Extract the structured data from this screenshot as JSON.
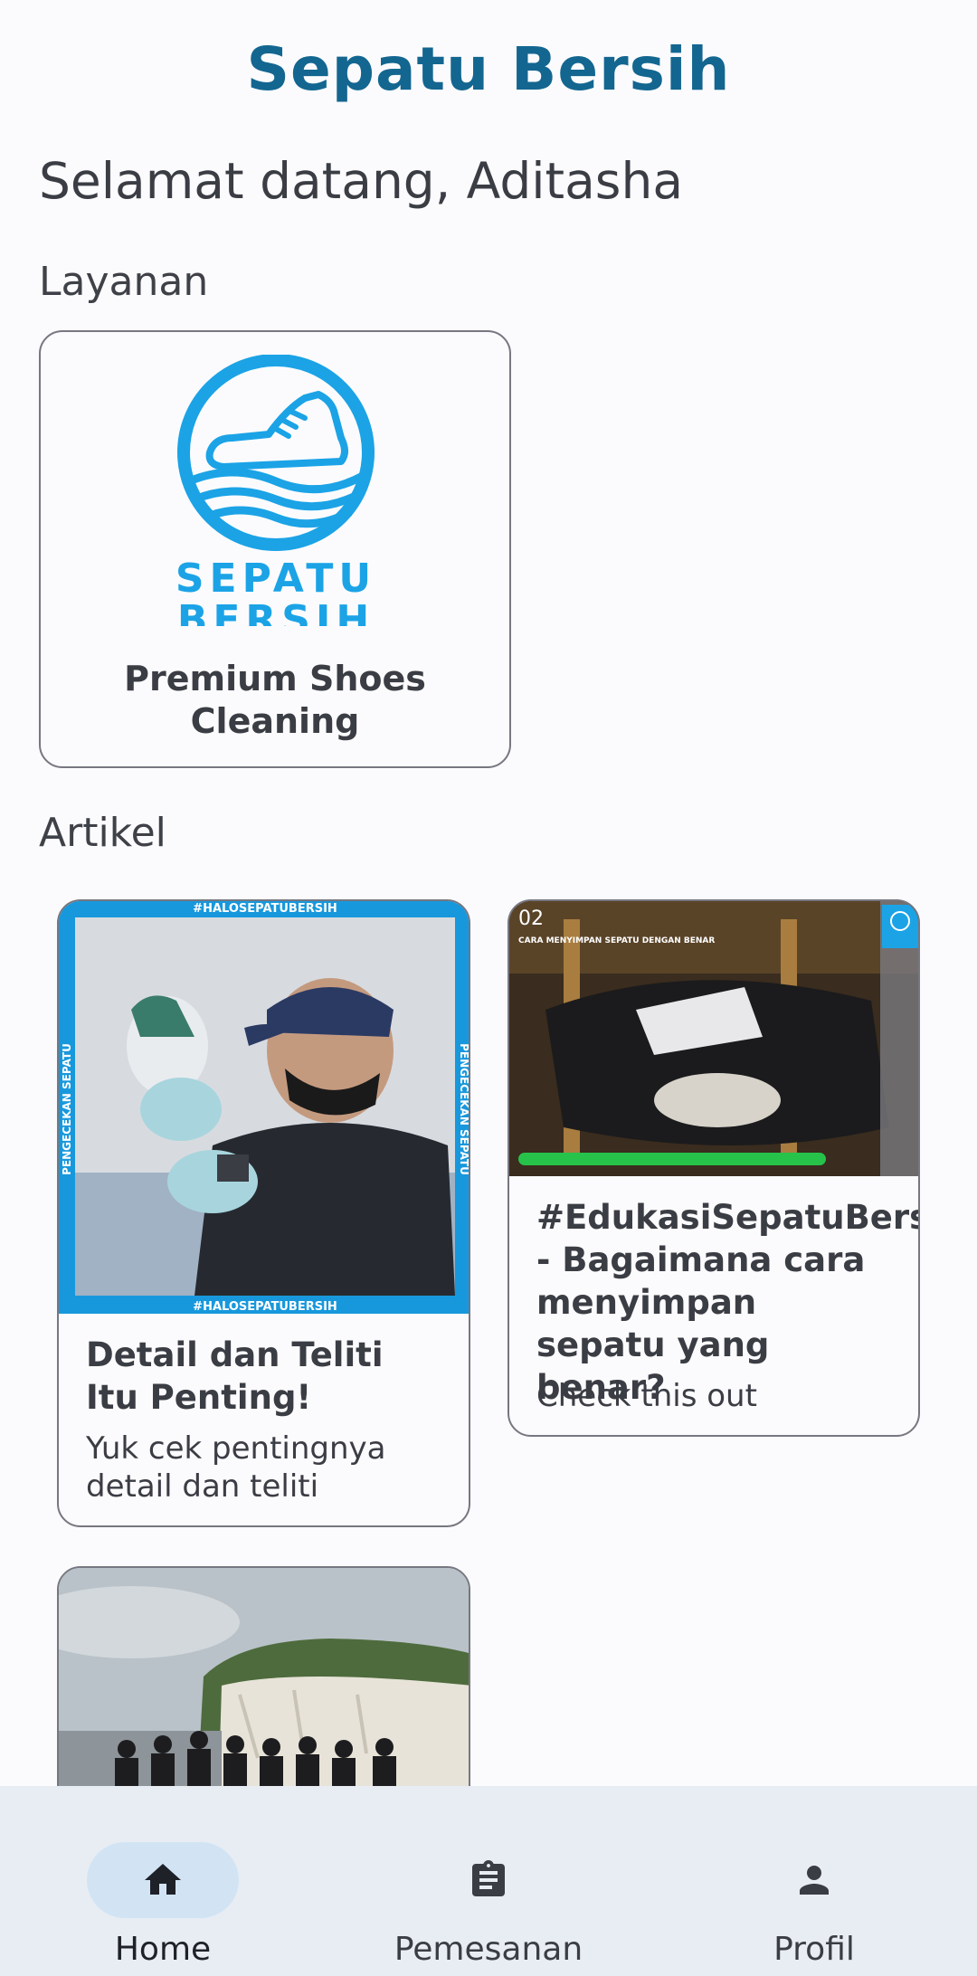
{
  "header": {
    "app_title": "Sepatu Bersih",
    "welcome": "Selamat datang, Aditasha"
  },
  "services": {
    "section_label": "Layanan",
    "items": [
      {
        "logo_text_line1": "SEPATU",
        "logo_text_line2": "BERSIH",
        "name": "Premium Shoes Cleaning"
      }
    ]
  },
  "articles": {
    "section_label": "Artikel",
    "items": [
      {
        "image_banner_top": "#HALOSEPATUBERSIH",
        "image_banner_bottom": "#HALOSEPATUBERSIH",
        "image_side_text": "PENGECEKAN SEPATU",
        "title": "Detail dan Teliti Itu Penting!",
        "subtitle": "Yuk cek pentingnya detail dan teliti"
      },
      {
        "image_number": "02",
        "image_caption": "CARA MENYIMPAN SEPATU DENGAN BENAR",
        "title": "#EdukasiSepatuBersih - Bagaimana cara menyimpan sepatu yang benar?",
        "subtitle": "Check this out"
      },
      {
        "title": "",
        "subtitle": ""
      }
    ]
  },
  "bottom_nav": {
    "items": [
      {
        "label": "Home",
        "icon": "home-icon",
        "active": true
      },
      {
        "label": "Pemesanan",
        "icon": "clipboard-icon",
        "active": false
      },
      {
        "label": "Profil",
        "icon": "person-icon",
        "active": false
      }
    ]
  },
  "colors": {
    "brand": "#136690",
    "logo_blue": "#1ba3e6",
    "nav_bg": "#e8edf3",
    "nav_active_pill": "#d2e4f4",
    "card_border": "#767780"
  }
}
